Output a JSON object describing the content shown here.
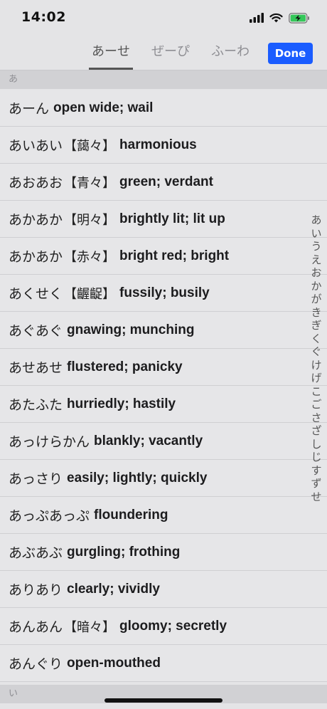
{
  "status": {
    "time": "14:02"
  },
  "tabs": [
    {
      "label": "あーせ",
      "active": true
    },
    {
      "label": "ぜーぴ",
      "active": false
    },
    {
      "label": "ふーわ",
      "active": false
    }
  ],
  "done_label": "Done",
  "sections": {
    "first": "あ",
    "next": "い"
  },
  "entries": [
    {
      "reading": "あーん",
      "kanji": "",
      "meaning": "open wide; wail"
    },
    {
      "reading": "あいあい",
      "kanji": "【藹々】",
      "meaning": "harmonious"
    },
    {
      "reading": "あおあお",
      "kanji": "【青々】",
      "meaning": "green; verdant"
    },
    {
      "reading": "あかあか",
      "kanji": "【明々】",
      "meaning": "brightly lit; lit up"
    },
    {
      "reading": "あかあか",
      "kanji": "【赤々】",
      "meaning": "bright red; bright"
    },
    {
      "reading": "あくせく",
      "kanji": "【齷齪】",
      "meaning": "fussily; busily"
    },
    {
      "reading": "あぐあぐ",
      "kanji": "",
      "meaning": "gnawing; munching"
    },
    {
      "reading": "あせあせ",
      "kanji": "",
      "meaning": "flustered; panicky"
    },
    {
      "reading": "あたふた",
      "kanji": "",
      "meaning": "hurriedly; hastily"
    },
    {
      "reading": "あっけらかん",
      "kanji": "",
      "meaning": "blankly; vacantly"
    },
    {
      "reading": "あっさり",
      "kanji": "",
      "meaning": "easily; lightly; quickly"
    },
    {
      "reading": "あっぷあっぷ",
      "kanji": "",
      "meaning": "floundering"
    },
    {
      "reading": "あぶあぶ",
      "kanji": "",
      "meaning": "gurgling; frothing"
    },
    {
      "reading": "ありあり",
      "kanji": "",
      "meaning": "clearly; vividly"
    },
    {
      "reading": "あんあん",
      "kanji": "【暗々】",
      "meaning": "gloomy; secretly"
    },
    {
      "reading": "あんぐり",
      "kanji": "",
      "meaning": "open-mouthed"
    }
  ],
  "index": [
    "あ",
    "い",
    "う",
    "え",
    "お",
    "か",
    "が",
    "き",
    "ぎ",
    "く",
    "ぐ",
    "け",
    "げ",
    "こ",
    "ご",
    "さ",
    "ざ",
    "し",
    "じ",
    "す",
    "ず",
    "せ"
  ],
  "colors": {
    "accent": "#1a5cff",
    "battery": "#34c759"
  }
}
